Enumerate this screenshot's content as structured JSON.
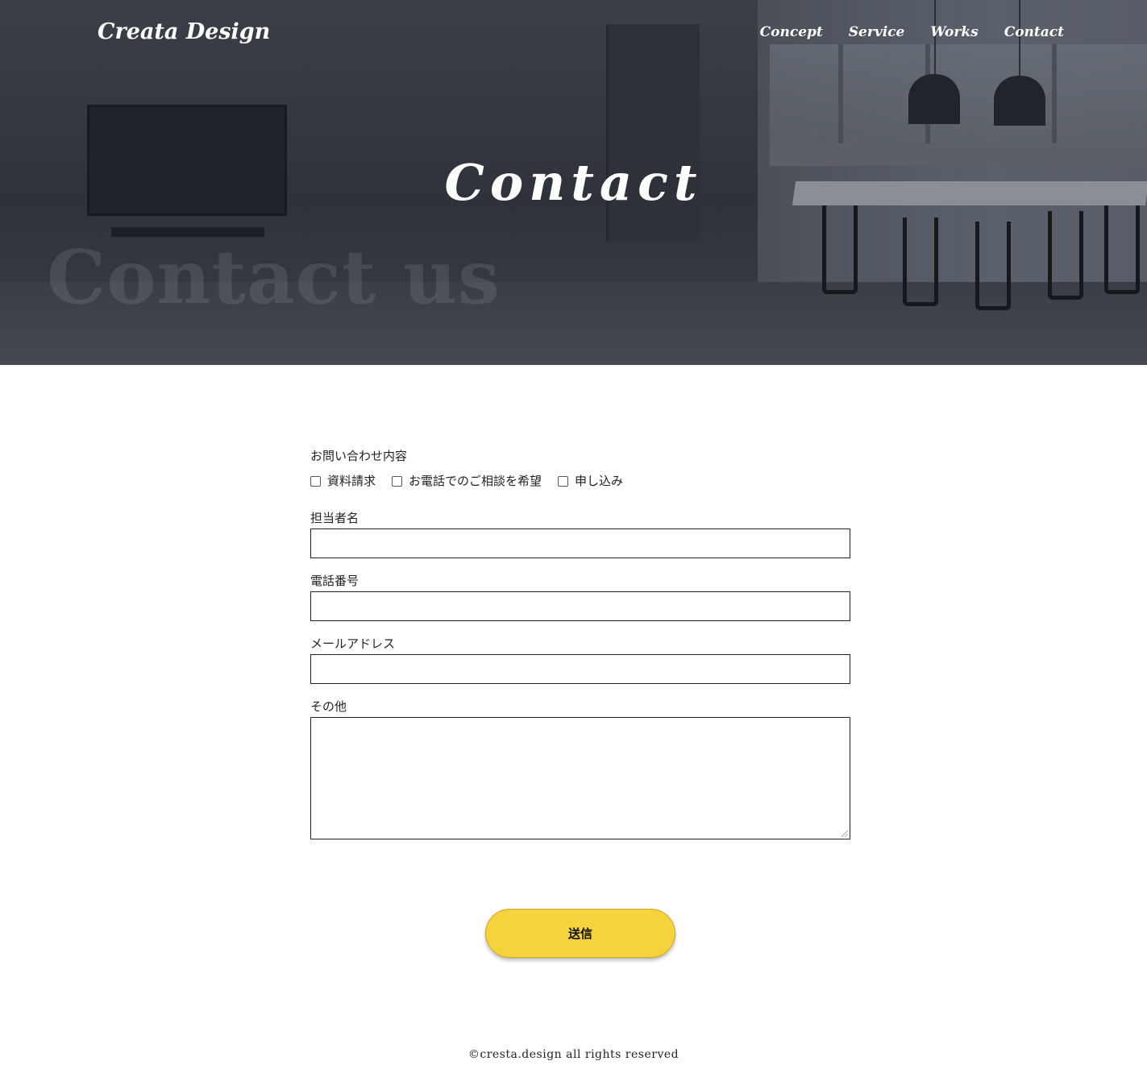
{
  "header": {
    "logo": "Creata Design",
    "nav": [
      "Concept",
      "Service",
      "Works",
      "Contact"
    ]
  },
  "hero": {
    "title": "Contact",
    "background_text": "Contact us"
  },
  "form": {
    "inquiry_label": "お問い合わせ内容",
    "options": [
      "資料請求",
      "お電話でのご相談を希望",
      "申し込み"
    ],
    "name_label": "担当者名",
    "phone_label": "電話番号",
    "email_label": "メールアドレス",
    "other_label": "その他",
    "submit_label": "送信"
  },
  "footer": {
    "copyright": "©cresta.design all rights reserved"
  },
  "colors": {
    "accent": "#f6d33c",
    "hero_overlay": "#2e323a"
  }
}
